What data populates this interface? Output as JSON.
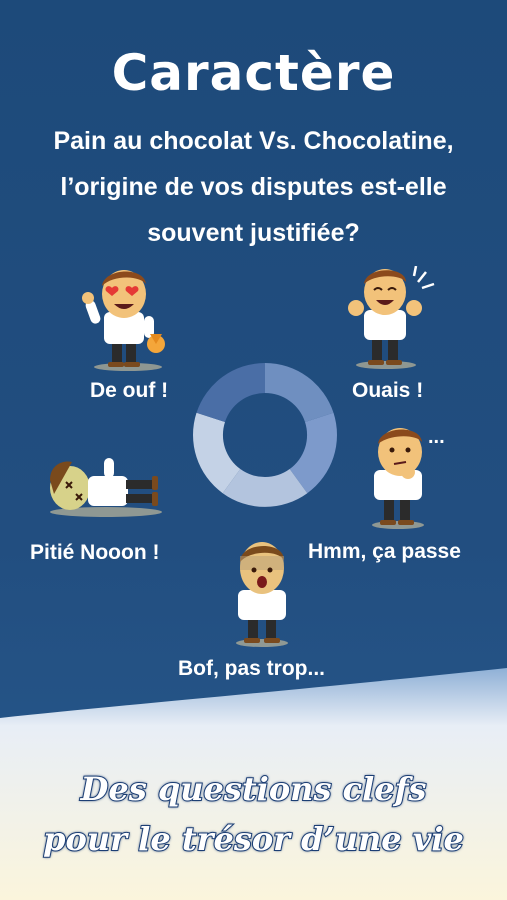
{
  "header": {
    "title": "Caractère",
    "question_lines": [
      "Pain au chocolat Vs. Chocolatine,",
      "l’origine de vos disputes est-elle",
      "souvent justifiée?"
    ]
  },
  "options": {
    "de_ouf": "De ouf !",
    "ouais": "Ouais !",
    "hmm": "Hmm, ça passe",
    "hmm_dots": "...",
    "bof": "Bof, pas trop...",
    "pitie": "Pitié Nooon !"
  },
  "footer": {
    "line1": "Des questions clefs",
    "line2": "pour le trésor d’une vie"
  },
  "icons": {
    "love_eyes": "heart-eyes-character-icon",
    "happy": "happy-character-icon",
    "thinking": "thinking-character-icon",
    "scared": "scared-character-icon",
    "knocked_out": "knocked-out-character-icon",
    "donut": "cycle-donut-icon"
  },
  "colors": {
    "background": "#1d4a7a",
    "donut_dark": "#4a6ea6",
    "donut_mid": "#6f8fc0",
    "donut_light": "#b3c4de",
    "medal": "#f4a63a"
  }
}
